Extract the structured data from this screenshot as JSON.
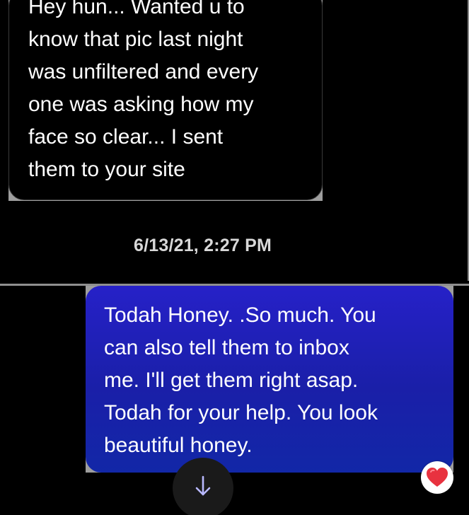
{
  "incoming_message": {
    "lines": [
      "Hey hun... Wanted u to",
      "know that pic last night",
      "was unfiltered and every",
      "one was asking how my",
      "face so clear... I sent",
      "them to your site"
    ]
  },
  "timestamp": "6/13/21, 2:27 PM",
  "outgoing_message": {
    "lines": [
      "Todah Honey. .So much. You",
      "can also tell them to inbox",
      "me. I'll get them right asap.",
      "Todah for your help. You look",
      "beautiful honey."
    ]
  },
  "reaction": {
    "icon": "heart-icon",
    "color": "#e8323f"
  },
  "scroll_button": {
    "icon": "arrow-down-icon"
  },
  "colors": {
    "outgoing_bubble": "#1f22b8",
    "incoming_bubble": "#000000",
    "background": "#000000"
  }
}
